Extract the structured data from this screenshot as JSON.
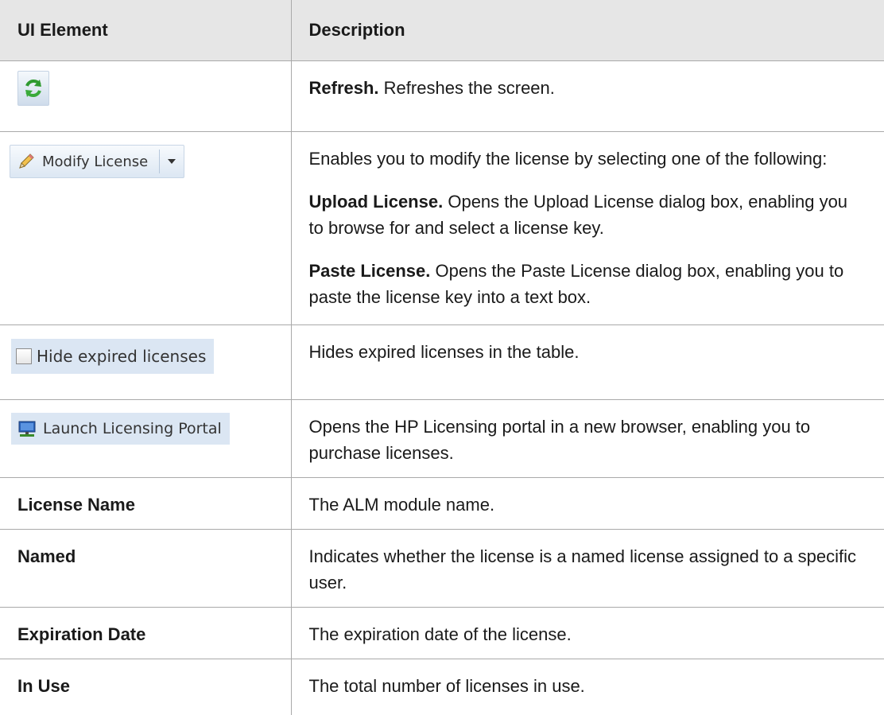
{
  "table": {
    "headers": [
      "UI Element",
      "Description"
    ],
    "refresh": {
      "icon": "refresh-icon",
      "term": "Refresh.",
      "desc": "Refreshes the screen."
    },
    "modify": {
      "button_label": "Modify License",
      "icon": "pencil-icon",
      "intro": "Enables you to modify the license by selecting one of the following:",
      "options": [
        {
          "term": "Upload License.",
          "desc": "Opens the Upload License dialog box, enabling you to browse for and select a license key."
        },
        {
          "term": "Paste License.",
          "desc": "Opens the Paste License dialog box, enabling you to paste the license key into a text box."
        }
      ]
    },
    "hide_expired": {
      "label": "Hide expired licenses",
      "checked": false,
      "desc": "Hides expired licenses in the table."
    },
    "portal": {
      "label": "Launch Licensing Portal",
      "icon": "monitor-icon",
      "desc": "Opens the HP Licensing portal in a new browser, enabling you to purchase licenses."
    },
    "rows": [
      {
        "element": "License Name",
        "desc": "The ALM module name."
      },
      {
        "element": "Named",
        "desc": "Indicates whether the license is a named license assigned to a specific user."
      },
      {
        "element": "Expiration Date",
        "desc": "The expiration date of the license."
      },
      {
        "element": "In Use",
        "desc": "The total number of licenses in use."
      }
    ]
  }
}
